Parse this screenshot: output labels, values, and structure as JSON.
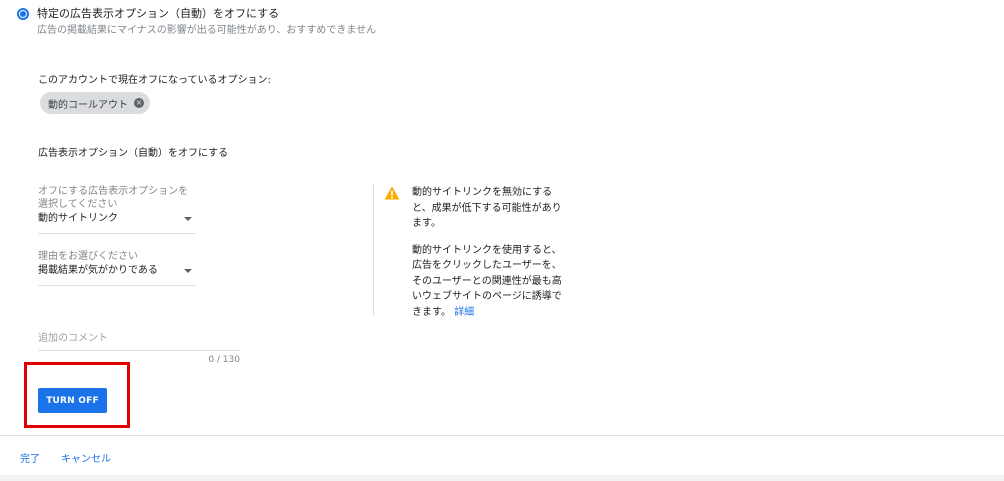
{
  "option": {
    "label": "特定の広告表示オプション（自動）をオフにする",
    "sublabel": "広告の掲載結果にマイナスの影響が出る可能性があり、おすすめできません",
    "selected": true
  },
  "current": {
    "label": "このアカウントで現在オフになっているオプション:",
    "chips": [
      {
        "label": "動的コールアウト",
        "icon": "close-circle-icon"
      }
    ]
  },
  "form": {
    "heading": "広告表示オプション（自動）をオフにする",
    "select_extension": {
      "label": "オフにする広告表示オプションを選択してください",
      "value": "動的サイトリンク"
    },
    "select_reason": {
      "label": "理由をお選びください",
      "value": "掲載結果が気がかりである"
    },
    "comment": {
      "placeholder": "追加のコメント",
      "counter": "0 / 130"
    },
    "submit_label": "TURN OFF"
  },
  "warning": {
    "icon": "warning-icon",
    "color": "#f9ab00",
    "line1": "動的サイトリンクを無効にすると、成果が低下する可能性があります。",
    "line2": "動的サイトリンクを使用すると、広告をクリックしたユーザーを、そのユーザーとの関連性が最も高いウェブサイトのページに誘導できます。",
    "link": "詳細"
  },
  "footer": {
    "done": "完了",
    "cancel": "キャンセル"
  },
  "colors": {
    "accent": "#1a73e8",
    "highlight": "#e00000"
  }
}
